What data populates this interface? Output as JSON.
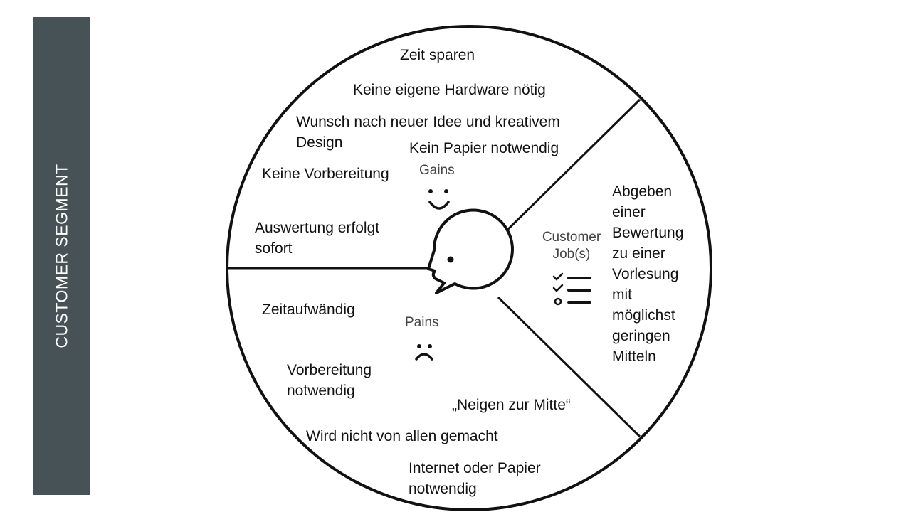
{
  "sidebar": {
    "label": "CUSTOMER SEGMENT"
  },
  "categories": {
    "gains": "Gains",
    "pains": "Pains",
    "jobs_line1": "Customer",
    "jobs_line2": "Job(s)"
  },
  "gains": {
    "item1": "Zeit sparen",
    "item2": "Keine eigene Hardware nötig",
    "item3_line1": "Wunsch nach neuer Idee und kreativem",
    "item3_line2": "Design",
    "item4": "Kein Papier notwendig",
    "item5": "Keine Vorbereitung",
    "item6_line1": "Auswertung erfolgt",
    "item6_line2": "sofort"
  },
  "pains": {
    "item1": "Zeitaufwändig",
    "item2_line1": "Vorbereitung",
    "item2_line2": "notwendig",
    "item3": "„Neigen zur Mitte“",
    "item4": "Wird nicht von allen gemacht",
    "item5_line1": "Internet oder Papier",
    "item5_line2": "notwendig"
  },
  "jobs": {
    "lines": [
      "Abgeben",
      "einer",
      "Bewertung",
      "zu einer",
      "Vorlesung",
      "mit",
      "möglichst",
      "geringen",
      "Mitteln"
    ]
  },
  "icons": {
    "face": "customer-face-icon",
    "gains": "smiley-icon",
    "pains": "frown-icon",
    "jobs": "checklist-icon"
  }
}
